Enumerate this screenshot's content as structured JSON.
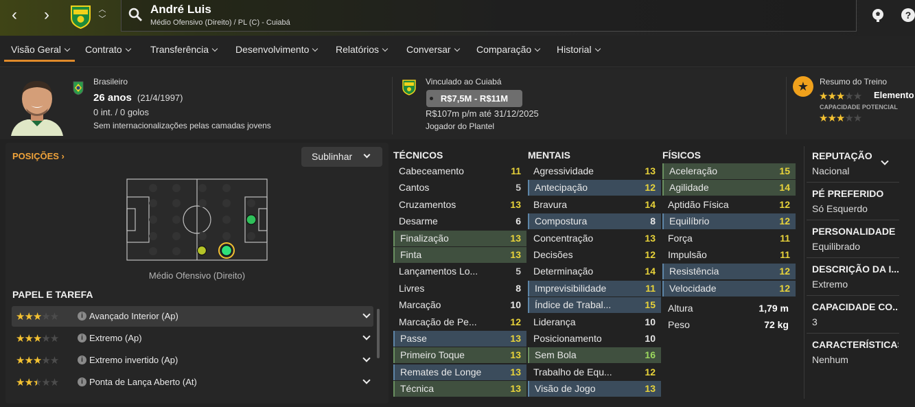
{
  "player": {
    "name": "André Luis",
    "subtitle": "Médio Ofensivo (Direito) / PL (C) - Cuiabá"
  },
  "tabs": [
    "Visão Geral",
    "Contrato",
    "Transferência",
    "Desenvolvimento",
    "Relatórios",
    "Conversar",
    "Comparação",
    "Historial"
  ],
  "header": {
    "nationality": "Brasileiro",
    "age": "26 anos",
    "birth": "(21/4/1997)",
    "caps": "0 int. / 0 golos",
    "youth_caps": "Sem internacionalizações pelas camadas jovens",
    "club_status": "Vinculado ao Cuiabá",
    "value_range": "R$7,5M - R$11M",
    "wage": "R$107m p/m até 31/12/2025",
    "squad_status": "Jogador do Plantel",
    "training_title": "Resumo do Treino",
    "current_ability_stars": 3,
    "ability_label": "Elemento",
    "potential_label": "CAPACIDADE POTENCIAL",
    "potential_stars": 3
  },
  "positions": {
    "title": "POSIÇÕES",
    "highlight_button": "Sublinhar",
    "position_label": "Médio Ofensivo (Direito)"
  },
  "roles": {
    "title": "PAPEL E TAREFA",
    "items": [
      {
        "label": "Avançado Interior (Ap)",
        "stars": 3
      },
      {
        "label": "Extremo (Ap)",
        "stars": 3
      },
      {
        "label": "Extremo invertido (Ap)",
        "stars": 3
      },
      {
        "label": "Ponta de Lança Aberto (At)",
        "stars": 2.5
      }
    ]
  },
  "technical": {
    "title": "TÉCNICOS",
    "items": [
      {
        "name": "Cabeceamento",
        "value": "11",
        "hl": "plain"
      },
      {
        "name": "Cantos",
        "value": "5",
        "hl": "plain"
      },
      {
        "name": "Cruzamentos",
        "value": "13",
        "hl": "plain"
      },
      {
        "name": "Desarme",
        "value": "6",
        "hl": "plain"
      },
      {
        "name": "Finalização",
        "value": "13",
        "hl": "green"
      },
      {
        "name": "Finta",
        "value": "13",
        "hl": "green"
      },
      {
        "name": "Lançamentos Lo...",
        "value": "5",
        "hl": "plain"
      },
      {
        "name": "Livres",
        "value": "8",
        "hl": "plain"
      },
      {
        "name": "Marcação",
        "value": "10",
        "hl": "plain"
      },
      {
        "name": "Marcação de Pe...",
        "value": "12",
        "hl": "plain"
      },
      {
        "name": "Passe",
        "value": "13",
        "hl": "blue"
      },
      {
        "name": "Primeiro Toque",
        "value": "13",
        "hl": "green"
      },
      {
        "name": "Remates de Longe",
        "value": "13",
        "hl": "blue"
      },
      {
        "name": "Técnica",
        "value": "13",
        "hl": "green"
      }
    ]
  },
  "mental": {
    "title": "MENTAIS",
    "items": [
      {
        "name": "Agressividade",
        "value": "13",
        "hl": "plain"
      },
      {
        "name": "Antecipação",
        "value": "12",
        "hl": "blue"
      },
      {
        "name": "Bravura",
        "value": "14",
        "hl": "plain"
      },
      {
        "name": "Compostura",
        "value": "8",
        "hl": "blue"
      },
      {
        "name": "Concentração",
        "value": "13",
        "hl": "plain"
      },
      {
        "name": "Decisões",
        "value": "12",
        "hl": "plain"
      },
      {
        "name": "Determinação",
        "value": "14",
        "hl": "plain"
      },
      {
        "name": "Imprevisibilidade",
        "value": "11",
        "hl": "blue"
      },
      {
        "name": "Índice de Trabal...",
        "value": "15",
        "hl": "blue"
      },
      {
        "name": "Liderança",
        "value": "10",
        "hl": "plain"
      },
      {
        "name": "Posicionamento",
        "value": "10",
        "hl": "plain"
      },
      {
        "name": "Sem Bola",
        "value": "16",
        "hl": "green"
      },
      {
        "name": "Trabalho de Equ...",
        "value": "12",
        "hl": "plain"
      },
      {
        "name": "Visão de Jogo",
        "value": "13",
        "hl": "blue"
      }
    ]
  },
  "physical": {
    "title": "FÍSICOS",
    "items": [
      {
        "name": "Aceleração",
        "value": "15",
        "hl": "green"
      },
      {
        "name": "Agilidade",
        "value": "14",
        "hl": "green"
      },
      {
        "name": "Aptidão Física",
        "value": "12",
        "hl": "plain"
      },
      {
        "name": "Equilíbrio",
        "value": "12",
        "hl": "blue"
      },
      {
        "name": "Força",
        "value": "11",
        "hl": "plain"
      },
      {
        "name": "Impulsão",
        "value": "11",
        "hl": "plain"
      },
      {
        "name": "Resistência",
        "value": "12",
        "hl": "blue"
      },
      {
        "name": "Velocidade",
        "value": "12",
        "hl": "blue"
      }
    ],
    "height_label": "Altura",
    "height": "1,79 m",
    "weight_label": "Peso",
    "weight": "72 kg"
  },
  "details": [
    {
      "label": "REPUTAÇÃO",
      "value": "Nacional"
    },
    {
      "label": "PÉ PREFERIDO",
      "value": "Só Esquerdo"
    },
    {
      "label": "PERSONALIDADE",
      "value": "Equilibrado"
    },
    {
      "label": "DESCRIÇÃO DA I...",
      "value": "Extremo"
    },
    {
      "label": "CAPACIDADE CO...",
      "value": "3"
    },
    {
      "label": "CARACTERÍSTICAS",
      "value": "Nenhum"
    }
  ],
  "colors": {
    "accent": "#e08a2a",
    "star": "#f4c232",
    "highlight_blue": "#3b4c5c",
    "highlight_green": "#40503f"
  }
}
